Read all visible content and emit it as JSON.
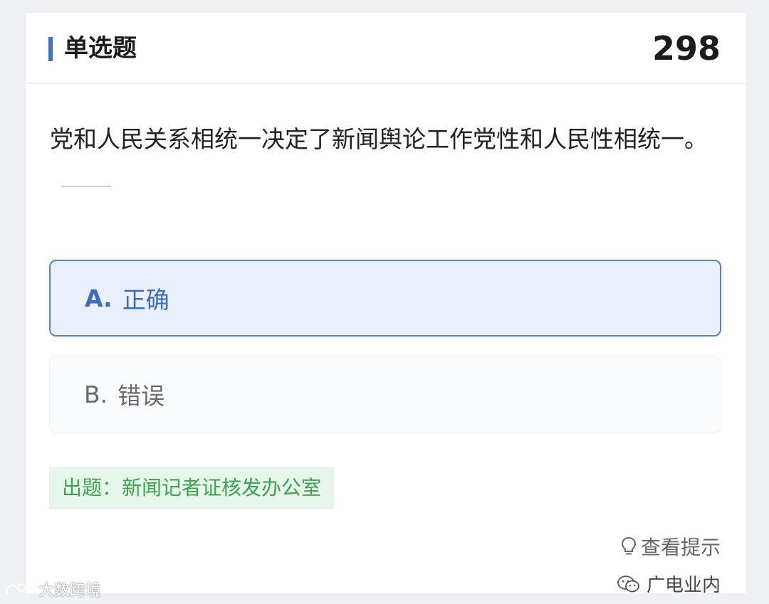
{
  "header": {
    "title": "单选题",
    "number": "298"
  },
  "question": {
    "text": "党和人民关系相统一决定了新闻舆论工作党性和人民性相统一。"
  },
  "options": [
    {
      "letter": "A.",
      "label": "正确",
      "selected": true
    },
    {
      "letter": "B.",
      "label": "错误",
      "selected": false
    }
  ],
  "source": {
    "text": "出题：新闻记者证核发办公室"
  },
  "hint": {
    "label": "查看提示",
    "icon": "lightbulb-icon"
  },
  "watermarks": {
    "right": "广电业内",
    "left": "大数跨境"
  },
  "colors": {
    "accent": "#3b73c9",
    "selected_bg": "#e9f0fc",
    "source_bg": "#e7f6ea",
    "source_text": "#3ca34f"
  }
}
